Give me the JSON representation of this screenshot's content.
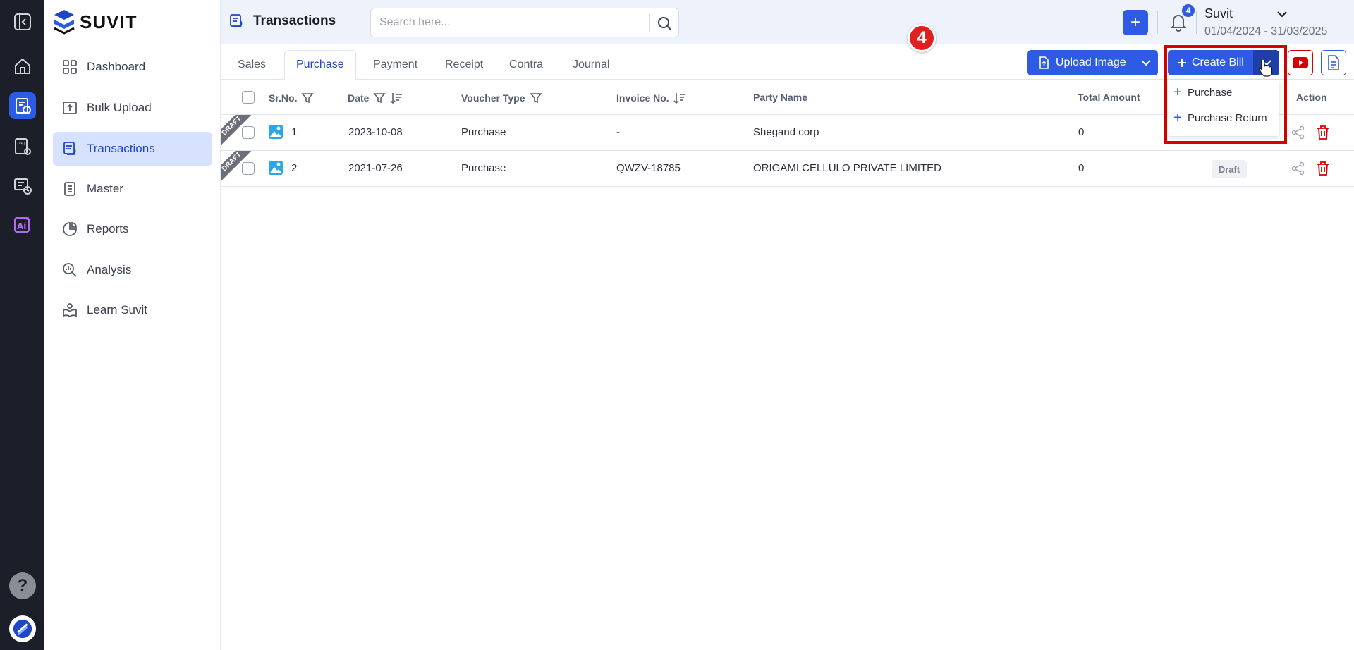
{
  "brand": {
    "name": "SUVIT"
  },
  "sidebar": {
    "items": [
      {
        "label": "Dashboard",
        "icon": "grid-icon"
      },
      {
        "label": "Bulk Upload",
        "icon": "upload-icon"
      },
      {
        "label": "Transactions",
        "icon": "transactions-icon",
        "active": true
      },
      {
        "label": "Master",
        "icon": "master-icon"
      },
      {
        "label": "Reports",
        "icon": "pie-chart-icon"
      },
      {
        "label": "Analysis",
        "icon": "analysis-icon"
      },
      {
        "label": "Learn Suvit",
        "icon": "learn-icon"
      }
    ]
  },
  "rail": {
    "help": "?"
  },
  "header": {
    "title": "Transactions",
    "search_placeholder": "Search here...",
    "plus": "+",
    "notifications_count": "4",
    "company": "Suvit",
    "period": "01/04/2024 - 31/03/2025",
    "step_badge": "4"
  },
  "tabs": [
    {
      "label": "Sales"
    },
    {
      "label": "Purchase",
      "active": true
    },
    {
      "label": "Payment"
    },
    {
      "label": "Receipt"
    },
    {
      "label": "Contra"
    },
    {
      "label": "Journal"
    }
  ],
  "toolbar": {
    "upload_label": "Upload Image",
    "create_label": "Create Bill",
    "create_menu": [
      "Purchase",
      "Purchase Return"
    ]
  },
  "table": {
    "headers": {
      "srno": "Sr.No.",
      "date": "Date",
      "voucher_type": "Voucher Type",
      "invoice_no": "Invoice No.",
      "party_name": "Party Name",
      "total_amount": "Total Amount",
      "action": "Action"
    },
    "rows": [
      {
        "ribbon": "DRAFT",
        "srno": "1",
        "date": "2023-10-08",
        "voucher_type": "Purchase",
        "invoice_no": "-",
        "party_name": "Shegand corp",
        "total_amount": "0",
        "status": ""
      },
      {
        "ribbon": "DRAFT",
        "srno": "2",
        "date": "2021-07-26",
        "voucher_type": "Purchase",
        "invoice_no": "QWZV-18785",
        "party_name": "ORIGAMI CELLULO PRIVATE LIMITED",
        "total_amount": "0",
        "status": "Draft"
      }
    ]
  },
  "colors": {
    "accent": "#2d5be3",
    "rail": "#1c1e2a",
    "danger": "#d40000"
  }
}
